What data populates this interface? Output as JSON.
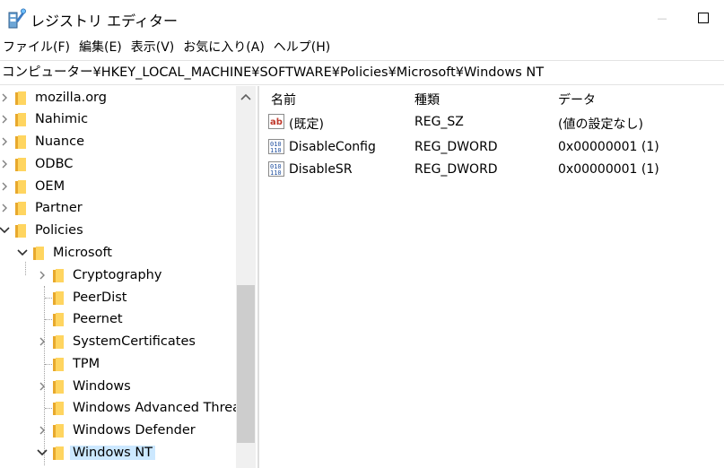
{
  "window": {
    "title": "レジストリ エディター",
    "icons": {
      "app": "registry-editor-icon",
      "minimize": "minimize-icon",
      "maximize": "maximize-icon"
    },
    "minimize_glyph": "—"
  },
  "menu": [
    "ファイル(F)",
    "編集(E)",
    "表示(V)",
    "お気に入り(A)",
    "ヘルプ(H)"
  ],
  "address": {
    "path": "コンピューター¥HKEY_LOCAL_MACHINE¥SOFTWARE¥Policies¥Microsoft¥Windows NT"
  },
  "tree": {
    "items": [
      {
        "label": "mozilla.org",
        "level": 0,
        "expander": "collapsed"
      },
      {
        "label": "Nahimic",
        "level": 0,
        "expander": "collapsed"
      },
      {
        "label": "Nuance",
        "level": 0,
        "expander": "collapsed"
      },
      {
        "label": "ODBC",
        "level": 0,
        "expander": "collapsed"
      },
      {
        "label": "OEM",
        "level": 0,
        "expander": "collapsed"
      },
      {
        "label": "Partner",
        "level": 0,
        "expander": "collapsed"
      },
      {
        "label": "Policies",
        "level": 0,
        "expander": "expanded"
      },
      {
        "label": "Microsoft",
        "level": 1,
        "expander": "expanded"
      },
      {
        "label": "Cryptography",
        "level": 2,
        "expander": "collapsed"
      },
      {
        "label": "PeerDist",
        "level": 2,
        "expander": "none"
      },
      {
        "label": "Peernet",
        "level": 2,
        "expander": "none"
      },
      {
        "label": "SystemCertificates",
        "level": 2,
        "expander": "collapsed"
      },
      {
        "label": "TPM",
        "level": 2,
        "expander": "none"
      },
      {
        "label": "Windows",
        "level": 2,
        "expander": "collapsed"
      },
      {
        "label": "Windows Advanced Threa",
        "level": 2,
        "expander": "none"
      },
      {
        "label": "Windows Defender",
        "level": 2,
        "expander": "collapsed"
      },
      {
        "label": "Windows NT",
        "level": 2,
        "expander": "expanded",
        "selected": true
      }
    ]
  },
  "values": {
    "headers": {
      "name": "名前",
      "type": "種類",
      "data": "データ"
    },
    "rows": [
      {
        "name": "(既定)",
        "type": "REG_SZ",
        "data": "(値の設定なし)",
        "icon": "string-value-icon"
      },
      {
        "name": "DisableConfig",
        "type": "REG_DWORD",
        "data": "0x00000001 (1)",
        "icon": "binary-value-icon"
      },
      {
        "name": "DisableSR",
        "type": "REG_DWORD",
        "data": "0x00000001 (1)",
        "icon": "binary-value-icon"
      }
    ]
  },
  "colors": {
    "folder": "#ffd560",
    "folder_back": "#e8a92d",
    "selection": "#cce8ff",
    "scroll_thumb": "#cdcdcd"
  }
}
